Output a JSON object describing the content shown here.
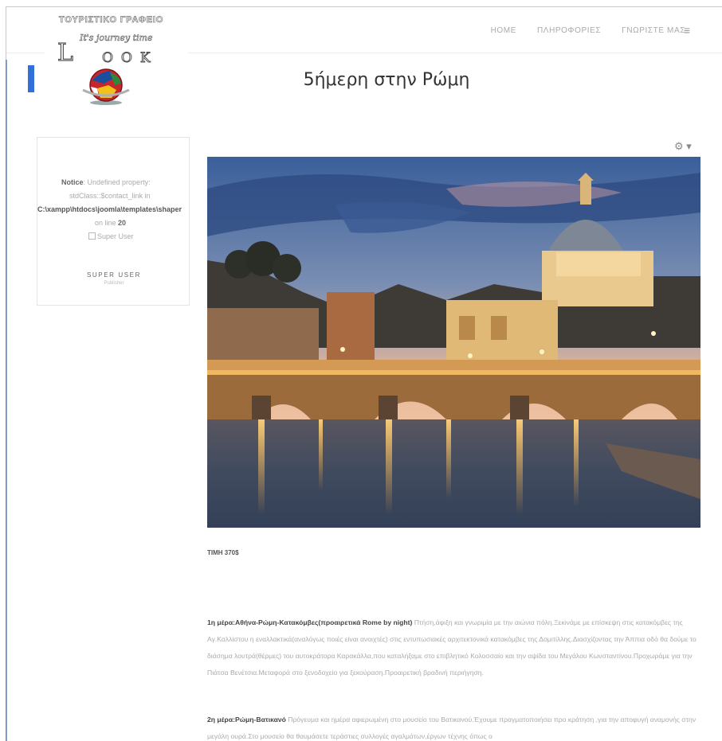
{
  "header": {
    "nav": [
      "HOME",
      "ΠΛΗΡΟΦΟΡΙΕΣ",
      "ΓΝΩΡΙΣΤΕ ΜΑΣ"
    ],
    "menu_icon": "hamburger-icon"
  },
  "logo": {
    "top_text": "ΤΟΥΡΙΣΤΙΚΟ ΓΡΑΦΕΙΟ",
    "tagline": "It's journey time",
    "big_letter": "L",
    "os_letters": "OOK"
  },
  "page": {
    "title": "5ήμερη στην Ρώμη"
  },
  "sidebar": {
    "notice_label": "Notice",
    "notice_text_1": ": Undefined property:",
    "notice_text_2": "stdClass::$contact_link in",
    "notice_path": "C:\\xampp\\htdocs\\joomla\\templates\\shaper",
    "notice_line_prefix": "on line ",
    "notice_line_number": "20",
    "avatar_alt": "Super User",
    "author_name": "SUPER USER",
    "author_role": "Publisher"
  },
  "article": {
    "options_icon": "gear-icon",
    "price": "ΤΙΜΗ  370$",
    "day1_title": "1η μέρα:Αθήνα-Ρώμη-Κατακόμβες(προαιρετικά Rome by night)",
    "day1_text": " Πτήση,άφιξη και γνωριμία με την αιώνια πόλη.Ξεκινάμε με επίσκεψη στις κατακόμβες της Αγ.Καλλίστου η εναλλακτικά(αναλόγως ποιές είναι ανοιχτές) στις εντυπωσιακές αρχιτεκτονικά κατακόμβες της Δομιτίλλης.Διασχίζοντας την Άππια οδό θα δούμε το διάσημα λουτρά(θέρμες) του αυτοκράτορα Καρακάλλα,που καταλήξαμε στο επιβλητικό Κολοσσαίο και την αψίδα του Μεγάλου Κωνσταντίνου.Προχωράμε για την Πιάτσα Βενέτσια.Μεταφορά στο ξενοδοχείο για ξεκούραση.Προαιρετική βραδινή περιήγηση.",
    "day2_title": "2η μέρα:Ρώμη-Βατικανό",
    "day2_text": " Πρόγευμα και ημέρα αφιερωμένη στο μουσείο του Βατικανού.Έχουμε πραγματοποιήσει προ κράτηση ,για την αποφυγή αναμονής στην μεγάλη ουρά.Στο μουσείο θα θαυμάσετε τεράστιες συλλογές αγαλμάτων,έργων τέχνης όπως ο"
  }
}
